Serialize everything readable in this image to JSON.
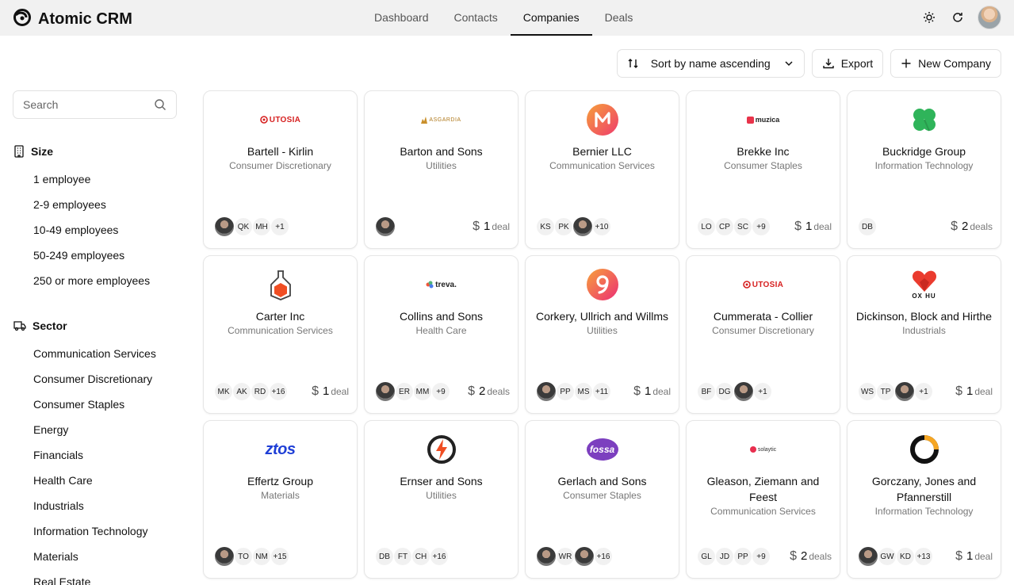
{
  "app": {
    "title": "Atomic CRM"
  },
  "nav": {
    "tabs": [
      {
        "label": "Dashboard",
        "active": false
      },
      {
        "label": "Contacts",
        "active": false
      },
      {
        "label": "Companies",
        "active": true
      },
      {
        "label": "Deals",
        "active": false
      }
    ]
  },
  "toolbar": {
    "sort_label": "Sort by name ascending",
    "export_label": "Export",
    "new_label": "New Company"
  },
  "search": {
    "placeholder": "Search"
  },
  "filters": {
    "size": {
      "title": "Size",
      "items": [
        "1 employee",
        "2-9 employees",
        "10-49 employees",
        "50-249 employees",
        "250 or more employees"
      ]
    },
    "sector": {
      "title": "Sector",
      "items": [
        "Communication Services",
        "Consumer Discretionary",
        "Consumer Staples",
        "Energy",
        "Financials",
        "Health Care",
        "Industrials",
        "Information Technology",
        "Materials",
        "Real Estate"
      ]
    }
  },
  "companies": [
    {
      "name": "Bartell - Kirlin",
      "sector": "Consumer Discretionary",
      "logo": "UTOSIA",
      "logo_icon": "utosia-logo",
      "avatars": [
        "@",
        "QK",
        "MH",
        "+1"
      ],
      "deal_count": "",
      "deal_word": ""
    },
    {
      "name": "Barton and Sons",
      "sector": "Utilities",
      "logo": "ASGARDIA",
      "logo_icon": "asgardia-logo",
      "avatars": [
        "@"
      ],
      "deal_count": "1",
      "deal_word": "deal"
    },
    {
      "name": "Bernier LLC",
      "sector": "Communication Services",
      "logo": "M",
      "logo_icon": "music-m-logo",
      "avatars": [
        "KS",
        "PK",
        "@",
        "+10"
      ],
      "deal_count": "",
      "deal_word": ""
    },
    {
      "name": "Brekke Inc",
      "sector": "Consumer Staples",
      "logo": "muzica",
      "logo_icon": "muzica-logo",
      "avatars": [
        "LO",
        "CP",
        "SC",
        "+9"
      ],
      "deal_count": "1",
      "deal_word": "deal"
    },
    {
      "name": "Buckridge Group",
      "sector": "Information Technology",
      "logo": "",
      "logo_icon": "clover-logo",
      "avatars": [
        "DB"
      ],
      "deal_count": "2",
      "deal_word": "deals"
    },
    {
      "name": "Carter Inc",
      "sector": "Communication Services",
      "logo": "",
      "logo_icon": "flask-logo",
      "avatars": [
        "MK",
        "AK",
        "RD",
        "+16"
      ],
      "deal_count": "1",
      "deal_word": "deal"
    },
    {
      "name": "Collins and Sons",
      "sector": "Health Care",
      "logo": "treva.",
      "logo_icon": "treva-logo",
      "avatars": [
        "@",
        "ER",
        "MM",
        "+9"
      ],
      "deal_count": "2",
      "deal_word": "deals"
    },
    {
      "name": "Corkery, Ullrich and Willms",
      "sector": "Utilities",
      "logo": "9",
      "logo_icon": "nine-logo",
      "avatars": [
        "@",
        "PP",
        "MS",
        "+11"
      ],
      "deal_count": "1",
      "deal_word": "deal"
    },
    {
      "name": "Cummerata - Collier",
      "sector": "Consumer Discretionary",
      "logo": "UTOSIA",
      "logo_icon": "utosia-logo",
      "avatars": [
        "BF",
        "DG",
        "@",
        "+1"
      ],
      "deal_count": "",
      "deal_word": ""
    },
    {
      "name": "Dickinson, Block and Hirthe",
      "sector": "Industrials",
      "logo": "OX HU",
      "logo_icon": "heart-logo",
      "avatars": [
        "WS",
        "TP",
        "@",
        "+1"
      ],
      "deal_count": "1",
      "deal_word": "deal"
    },
    {
      "name": "Effertz Group",
      "sector": "Materials",
      "logo": "ztos",
      "logo_icon": "ztos-logo",
      "avatars": [
        "@",
        "TO",
        "NM",
        "+15"
      ],
      "deal_count": "",
      "deal_word": ""
    },
    {
      "name": "Ernser and Sons",
      "sector": "Utilities",
      "logo": "",
      "logo_icon": "bolt-logo",
      "avatars": [
        "DB",
        "FT",
        "CH",
        "+16"
      ],
      "deal_count": "",
      "deal_word": ""
    },
    {
      "name": "Gerlach and Sons",
      "sector": "Consumer Staples",
      "logo": "fossa",
      "logo_icon": "fossa-logo",
      "avatars": [
        "@",
        "WR",
        "@",
        "+16"
      ],
      "deal_count": "",
      "deal_word": ""
    },
    {
      "name": "Gleason, Ziemann and Feest",
      "sector": "Communication Services",
      "logo": "solaytic",
      "logo_icon": "solaytic-logo",
      "avatars": [
        "GL",
        "JD",
        "PP",
        "+9"
      ],
      "deal_count": "2",
      "deal_word": "deals"
    },
    {
      "name": "Gorczany, Jones and Pfannerstill",
      "sector": "Information Technology",
      "logo": "",
      "logo_icon": "ring-logo",
      "avatars": [
        "@",
        "GW",
        "KD",
        "+13"
      ],
      "deal_count": "1",
      "deal_word": "deal"
    }
  ]
}
